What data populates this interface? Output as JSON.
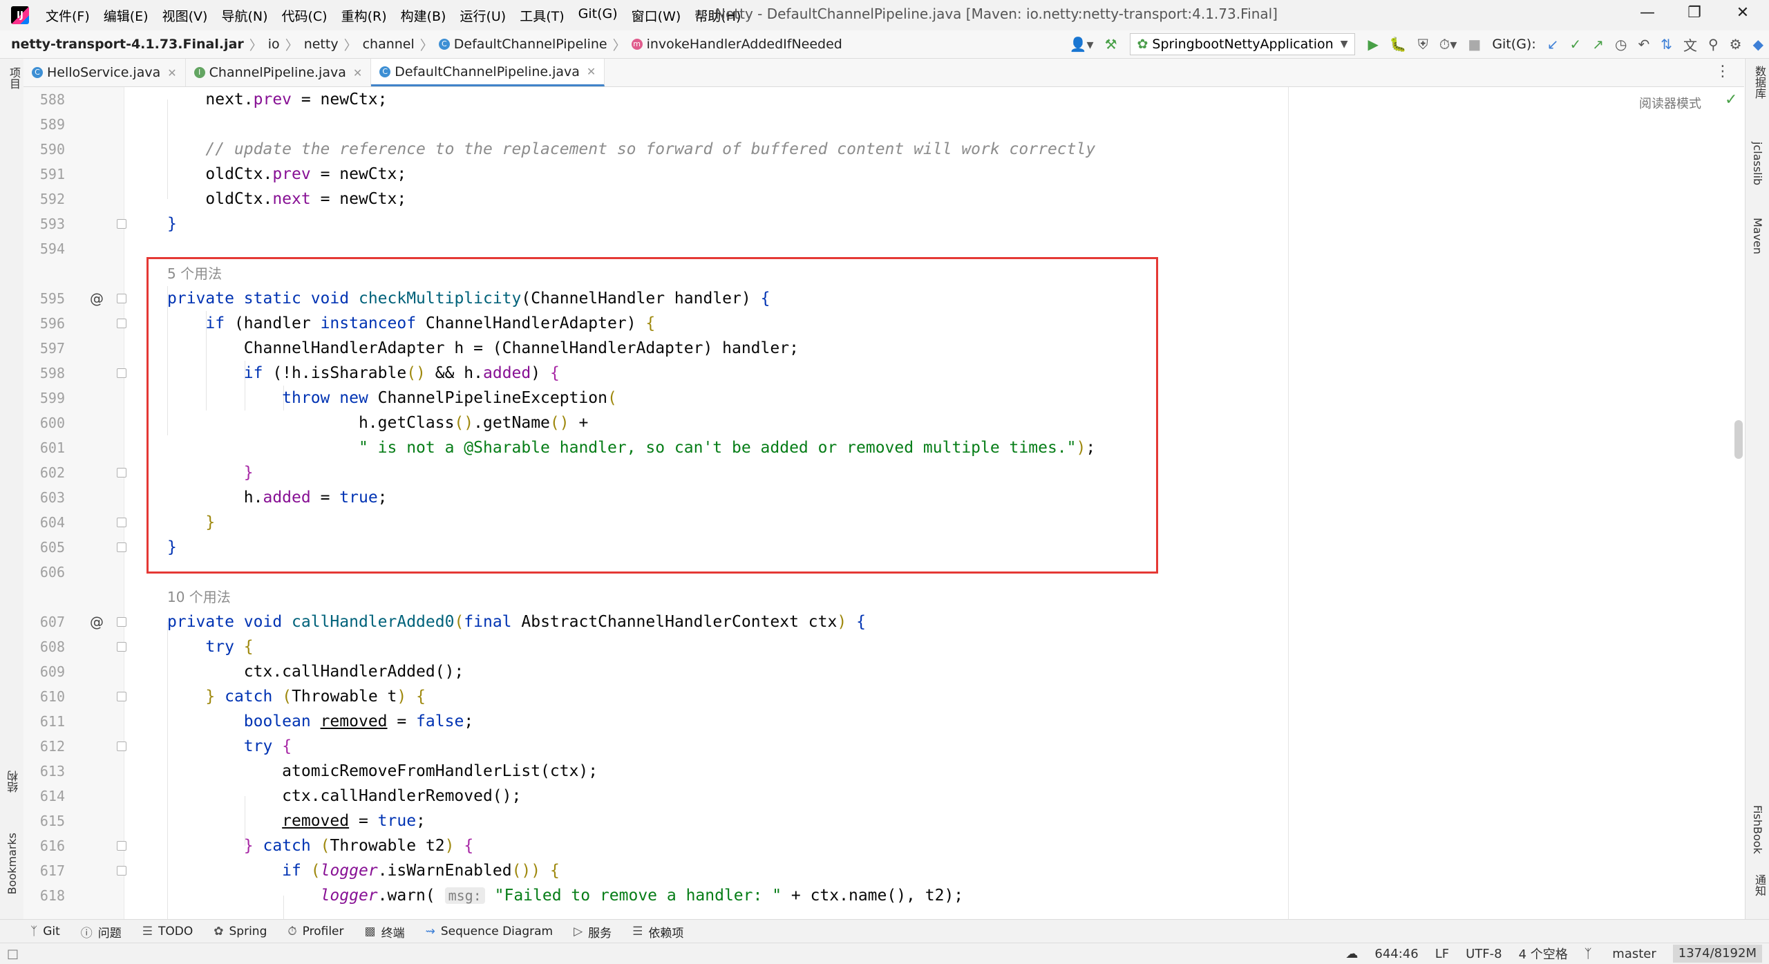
{
  "window": {
    "title": "Netty - DefaultChannelPipeline.java [Maven: io.netty:netty-transport:4.1.73.Final]",
    "menu": [
      "文件(F)",
      "编辑(E)",
      "视图(V)",
      "导航(N)",
      "代码(C)",
      "重构(R)",
      "构建(B)",
      "运行(U)",
      "工具(T)",
      "Git(G)",
      "窗口(W)",
      "帮助(H)"
    ]
  },
  "breadcrumbs": [
    "netty-transport-4.1.73.Final.jar",
    "io",
    "netty",
    "channel",
    "DefaultChannelPipeline",
    "invokeHandlerAddedIfNeeded"
  ],
  "toolbar": {
    "run_config": "SpringbootNettyApplication",
    "git_label": "Git(G):"
  },
  "tabs": [
    {
      "label": "HelloService.java",
      "badge": "C"
    },
    {
      "label": "ChannelPipeline.java",
      "badge": "I"
    },
    {
      "label": "DefaultChannelPipeline.java",
      "badge": "C",
      "active": true
    }
  ],
  "editor": {
    "reader_mode": "阅读器模式",
    "usage_hint_1": "5 个用法",
    "usage_hint_2": "10 个用法",
    "inlay_msg": "msg:",
    "line_numbers": [
      "588",
      "589",
      "590",
      "591",
      "592",
      "593",
      "594",
      "595",
      "596",
      "597",
      "598",
      "599",
      "600",
      "601",
      "602",
      "603",
      "604",
      "605",
      "606",
      "607",
      "608",
      "609",
      "610",
      "611",
      "612",
      "613",
      "614",
      "615",
      "616",
      "617",
      "618"
    ],
    "comment_590": "// update the reference to the replacement so forward of buffered content will work correctly",
    "string_601": "\" is not a @Sharable handler, so can't be added or removed multiple times.\"",
    "string_618": "\"Failed to remove a handler: \""
  },
  "right_tools": [
    "数据库",
    "jclasslib",
    "Maven",
    "FishBook",
    "通知"
  ],
  "left_tools": [
    "项目",
    "结构",
    "Bookmarks"
  ],
  "bottom_tools": [
    "Git",
    "问题",
    "TODO",
    "Spring",
    "Profiler",
    "终端",
    "Sequence Diagram",
    "服务",
    "依赖项"
  ],
  "status": {
    "position": "644:46",
    "line_sep": "LF",
    "encoding": "UTF-8",
    "indent": "4 个空格",
    "branch": "master",
    "memory": "1374/8192M"
  }
}
